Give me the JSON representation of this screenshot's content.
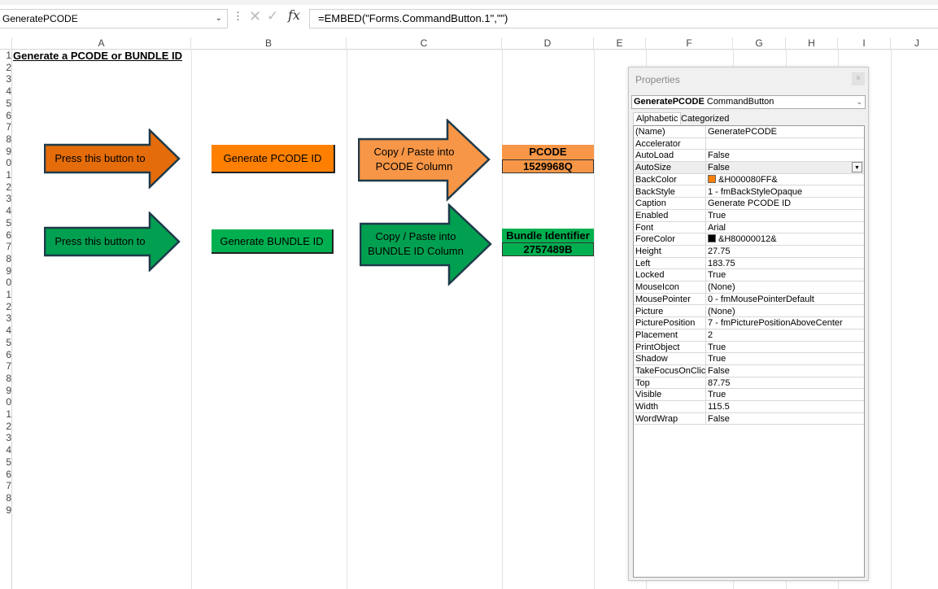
{
  "formula_bar": {
    "name_box": "GeneratePCODE",
    "dots": "⋮",
    "cancel_icon": "✕",
    "enter_icon": "✓",
    "fx_label": "fx",
    "formula": "=EMBED(\"Forms.CommandButton.1\",\"\")"
  },
  "columns": [
    "A",
    "B",
    "C",
    "D",
    "E",
    "F",
    "G",
    "H",
    "I",
    "J"
  ],
  "rows": [
    "1",
    "2",
    "3",
    "4",
    "5",
    "6",
    "7",
    "8",
    "9",
    "0",
    "1",
    "2",
    "3",
    "4",
    "5",
    "6",
    "7",
    "8",
    "9",
    "0",
    "1",
    "2",
    "3",
    "4",
    "5",
    "6",
    "7",
    "8",
    "9",
    "0",
    "1",
    "2",
    "3",
    "4",
    "5",
    "6",
    "7",
    "8",
    "9"
  ],
  "sheet": {
    "title": "Generate a PCODE or BUNDLE ID",
    "pcode_arrow_label": "Press this button to",
    "pcode_button": "Generate PCODE ID",
    "pcode_copy_line1": "Copy / Paste into",
    "pcode_copy_line2": "PCODE Column",
    "pcode_header": "PCODE",
    "pcode_value": "1529968Q",
    "bundle_arrow_label": "Press this button to",
    "bundle_button": "Generate BUNDLE ID",
    "bundle_copy_line1": "Copy / Paste into",
    "bundle_copy_line2": "BUNDLE ID Column",
    "bundle_header": "Bundle Identifier",
    "bundle_value": "2757489B"
  },
  "colors": {
    "orange_dark": "#E46C0A",
    "orange_button": "#FF8000",
    "orange_light": "#F79646",
    "green": "#00B050",
    "green_dark": "#00A050"
  },
  "properties": {
    "title": "Properties",
    "close": "×",
    "object_name": "GeneratePCODE",
    "object_type": "CommandButton",
    "tab_alphabetic": "Alphabetic",
    "tab_categorized": "Categorized",
    "rows": [
      {
        "name": "(Name)",
        "value": "GeneratePCODE"
      },
      {
        "name": "Accelerator",
        "value": ""
      },
      {
        "name": "AutoLoad",
        "value": "False"
      },
      {
        "name": "AutoSize",
        "value": "False"
      },
      {
        "name": "BackColor",
        "value": "&H000080FF&"
      },
      {
        "name": "BackStyle",
        "value": "1 - fmBackStyleOpaque"
      },
      {
        "name": "Caption",
        "value": "Generate PCODE ID"
      },
      {
        "name": "Enabled",
        "value": "True"
      },
      {
        "name": "Font",
        "value": "Arial"
      },
      {
        "name": "ForeColor",
        "value": "&H80000012&"
      },
      {
        "name": "Height",
        "value": "27.75"
      },
      {
        "name": "Left",
        "value": "183.75"
      },
      {
        "name": "Locked",
        "value": "True"
      },
      {
        "name": "MouseIcon",
        "value": "(None)"
      },
      {
        "name": "MousePointer",
        "value": "0 - fmMousePointerDefault"
      },
      {
        "name": "Picture",
        "value": "(None)"
      },
      {
        "name": "PicturePosition",
        "value": "7 - fmPicturePositionAboveCenter"
      },
      {
        "name": "Placement",
        "value": "2"
      },
      {
        "name": "PrintObject",
        "value": "True"
      },
      {
        "name": "Shadow",
        "value": "True"
      },
      {
        "name": "TakeFocusOnClick",
        "value": "False"
      },
      {
        "name": "Top",
        "value": "87.75"
      },
      {
        "name": "Visible",
        "value": "True"
      },
      {
        "name": "Width",
        "value": "115.5"
      },
      {
        "name": "WordWrap",
        "value": "False"
      }
    ],
    "backcolor_swatch": "#FF8000",
    "forecolor_swatch": "#000000"
  }
}
